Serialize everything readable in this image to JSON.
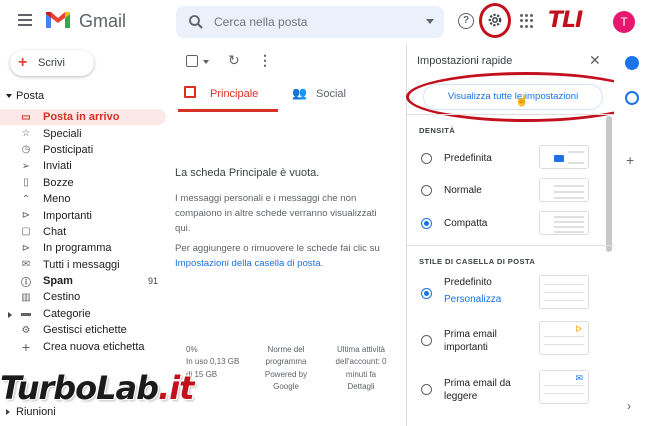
{
  "app": {
    "name": "Gmail"
  },
  "search": {
    "placeholder": "Cerca nella posta"
  },
  "account": {
    "initial": "T",
    "avatar_color": "#e8176e"
  },
  "header_logo": {
    "text": "TLI",
    "color": "#c3101d"
  },
  "compose": {
    "label": "Scrivi"
  },
  "sidebar": {
    "section": "Posta",
    "items": [
      {
        "label": "Posta in arrivo",
        "icon": "inbox-icon",
        "glyph": "▭",
        "active": true
      },
      {
        "label": "Speciali",
        "icon": "star-icon",
        "glyph": "☆"
      },
      {
        "label": "Posticipati",
        "icon": "clock-icon",
        "glyph": "◷"
      },
      {
        "label": "Inviati",
        "icon": "send-icon",
        "glyph": "➢"
      },
      {
        "label": "Bozze",
        "icon": "draft-icon",
        "glyph": "▯"
      },
      {
        "label": "Meno",
        "icon": "chevron-up-icon",
        "glyph": "⌃"
      },
      {
        "label": "Importanti",
        "icon": "important-icon",
        "glyph": "⊳"
      },
      {
        "label": "Chat",
        "icon": "chat-icon",
        "glyph": "▢"
      },
      {
        "label": "In programma",
        "icon": "scheduled-icon",
        "glyph": "⊳"
      },
      {
        "label": "Tutti i messaggi",
        "icon": "all-mail-icon",
        "glyph": "✉"
      },
      {
        "label": "Spam",
        "icon": "spam-icon",
        "glyph": "ⓘ",
        "count": "91",
        "bold": true
      },
      {
        "label": "Cestino",
        "icon": "trash-icon",
        "glyph": "🗑"
      },
      {
        "label": "Categorie",
        "icon": "label-icon",
        "glyph": "▬",
        "expandable": true
      },
      {
        "label": "Gestisci etichette",
        "icon": "gear-icon",
        "glyph": "⚙"
      },
      {
        "label": "Crea nuova etichetta",
        "icon": "plus-icon",
        "glyph": "+"
      }
    ],
    "meetings": "Riunioni"
  },
  "tabs": [
    {
      "label": "Principale",
      "icon": "inbox-tab-icon"
    },
    {
      "label": "Social",
      "icon": "people-icon"
    }
  ],
  "empty_state": {
    "title": "La scheda Principale è vuota.",
    "p1": "I messaggi personali e i messaggi che non compaiono in altre schede verranno visualizzati qui.",
    "p2_prefix": "Per aggiungere o rimuovere le schede fai clic su ",
    "p2_link": "Impostazioni della casella di posta",
    "p2_suffix": "."
  },
  "footer": {
    "storage_percent": "0%",
    "storage_used": "In uso 0,13 GB",
    "storage_total": "di 15 GB",
    "program_l1": "Norme del",
    "program_l2": "programma",
    "program_l3": "Powered by",
    "program_l4": "Google",
    "activity_l1": "Ultima attività",
    "activity_l2": "dell'account: 0",
    "activity_l3": "minuti fa",
    "activity_l4": "Dettagli"
  },
  "watermark": {
    "part1": "TurboLab",
    "part2": ".it"
  },
  "quick_settings": {
    "title": "Impostazioni rapide",
    "view_all": "Visualizza tutte le impostazioni",
    "density_title": "DENSITÀ",
    "density_options": [
      {
        "label": "Predefinita",
        "selected": false
      },
      {
        "label": "Normale",
        "selected": false
      },
      {
        "label": "Compatta",
        "selected": true
      }
    ],
    "inbox_title": "STILE DI CASELLA DI POSTA",
    "inbox_options": [
      {
        "label": "Predefinito",
        "sub": "Personalizza",
        "selected": true
      },
      {
        "label_l1": "Prima email",
        "label_l2": "importanti",
        "selected": false
      },
      {
        "label_l1": "Prima email da",
        "label_l2": "leggere",
        "selected": false
      }
    ]
  },
  "colors": {
    "accent_red": "#d93025",
    "link_blue": "#1a73e8",
    "annotation_red": "#c3101d"
  }
}
